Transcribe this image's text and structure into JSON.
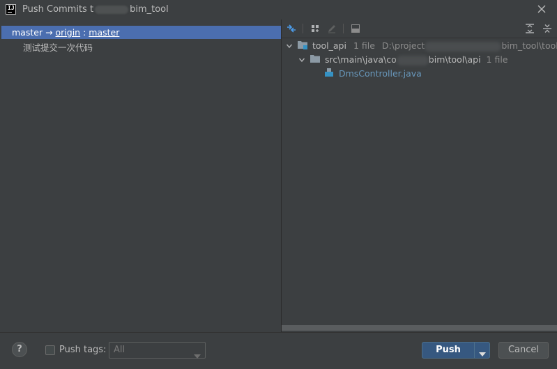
{
  "window": {
    "title_prefix": "Push Commits t",
    "title_suffix": "bim_tool",
    "app_icon_text": "IJ"
  },
  "commits": {
    "branch_local": "master",
    "arrow": " → ",
    "remote": "origin",
    "separator": " : ",
    "branch_remote": "master",
    "items": [
      "测试提交一次代码"
    ]
  },
  "tree": {
    "root": {
      "name": "tool_api",
      "count": "1 file",
      "path_prefix": "D:\\project",
      "path_suffix": "bim_tool\\tool_a"
    },
    "folder": {
      "name_prefix": "src\\main\\java\\co",
      "name_suffix": "bim\\tool\\api",
      "count": "1 file"
    },
    "file": {
      "name": "DmsController.java"
    }
  },
  "footer": {
    "help_label": "?",
    "push_tags_label": "Push tags:",
    "tags_value": "All",
    "push_label": "Push",
    "cancel_label": "Cancel"
  },
  "colors": {
    "selection": "#4b6eaf",
    "primary_button": "#365880",
    "file_link": "#6897bb"
  }
}
